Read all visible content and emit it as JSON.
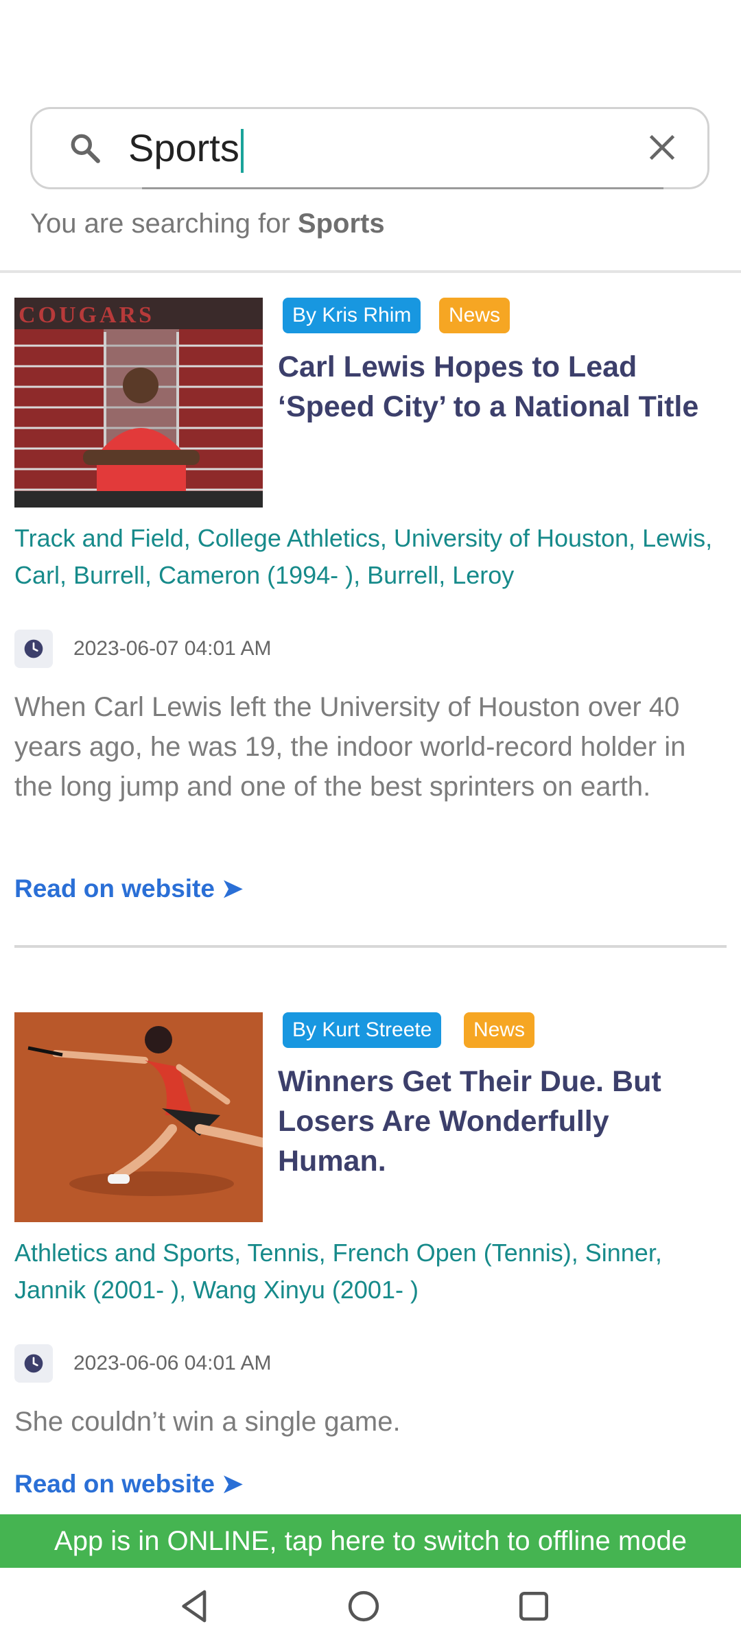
{
  "search": {
    "value": "Sports",
    "hint_prefix": "You are searching for",
    "hint_term": "Sports"
  },
  "articles": [
    {
      "author": "By Kris Rhim",
      "type": "News",
      "title": "Carl Lewis Hopes to Lead ‘Speed City’ to a National Title",
      "tags": "Track and Field, College Athletics, University of Houston, Lewis, Carl, Burrell, Cameron (1994- ), Burrell, Leroy",
      "date": "2023-06-07 04:01 AM",
      "summary": "When Carl Lewis left the University of Houston over 40 years ago, he was 19, the indoor world-record holder in the long jump and one of the best sprinters on earth.",
      "read_label": "Read on website ➤",
      "image_text": "COUGARS"
    },
    {
      "author": "By Kurt Streete",
      "type": "News",
      "title": "Winners Get Their Due. But Losers Are Wonderfully Human.",
      "tags": "Athletics and Sports, Tennis, French Open (Tennis), Sinner, Jannik (2001- ), Wang Xinyu (2001- )",
      "date": "2023-06-06 04:01 AM",
      "summary": "She couldn’t win a single game.",
      "read_label": "Read on website ➤"
    }
  ],
  "banner": {
    "text": "App is in ONLINE, tap here to switch to offline mode"
  },
  "navbar": {
    "back": "back-icon",
    "home": "home-icon",
    "recents": "recents-icon"
  },
  "colors": {
    "accent": "#1aa39a",
    "banner": "#45b451",
    "title": "#3c3f6b",
    "tags": "#168a8a",
    "link": "#2a6fd6"
  }
}
